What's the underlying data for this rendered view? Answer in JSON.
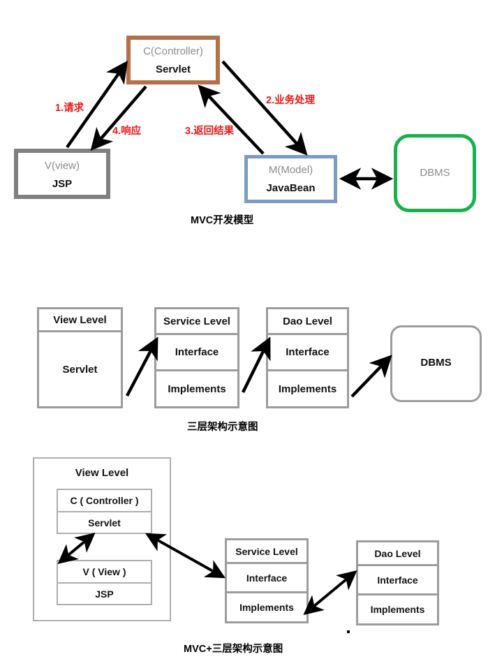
{
  "diagram": {
    "title_top": "MVC开发模型",
    "title_middle": "三层架构示意图",
    "title_bottom": "MVC+三层架构示意图"
  },
  "mvc": {
    "controller": {
      "top": "C(Controller)",
      "bottom": "Servlet"
    },
    "view": {
      "top": "V(view)",
      "bottom": "JSP"
    },
    "model": {
      "top": "M(Model)",
      "bottom": "JavaBean"
    },
    "dbms": {
      "label": "DBMS"
    },
    "flows": [
      {
        "id": "1",
        "label": "1.请求"
      },
      {
        "id": "2",
        "label": "2.业务处理"
      },
      {
        "id": "3",
        "label": "3.返回结果"
      },
      {
        "id": "4",
        "label": "4.响应"
      }
    ],
    "colors": {
      "controller_border": "#b2714a",
      "view_border": "#808080",
      "model_border": "#7d9cc3",
      "dbms_border": "#18b14b",
      "flow_label": "#f21616",
      "muted_text": "#8c8c8c"
    }
  },
  "three_layer": {
    "view_level": {
      "header": "View Level",
      "body": "Servlet"
    },
    "service_level": {
      "header": "Service Level",
      "rows": [
        "Interface",
        "Implements"
      ]
    },
    "dao_level": {
      "header": "Dao Level",
      "rows": [
        "Interface",
        "Implements"
      ]
    },
    "dbms": {
      "label": "DBMS"
    }
  },
  "mvc_three_layer": {
    "view_level": {
      "header": "View Level",
      "controller": {
        "header": "C ( Controller )",
        "body": "Servlet"
      },
      "view": {
        "header": "V ( View )",
        "body": "JSP"
      }
    },
    "service_level": {
      "header": "Service Level",
      "rows": [
        "Interface",
        "Implements"
      ]
    },
    "dao_level": {
      "header": "Dao Level",
      "rows": [
        "Interface",
        "Implements"
      ]
    }
  }
}
